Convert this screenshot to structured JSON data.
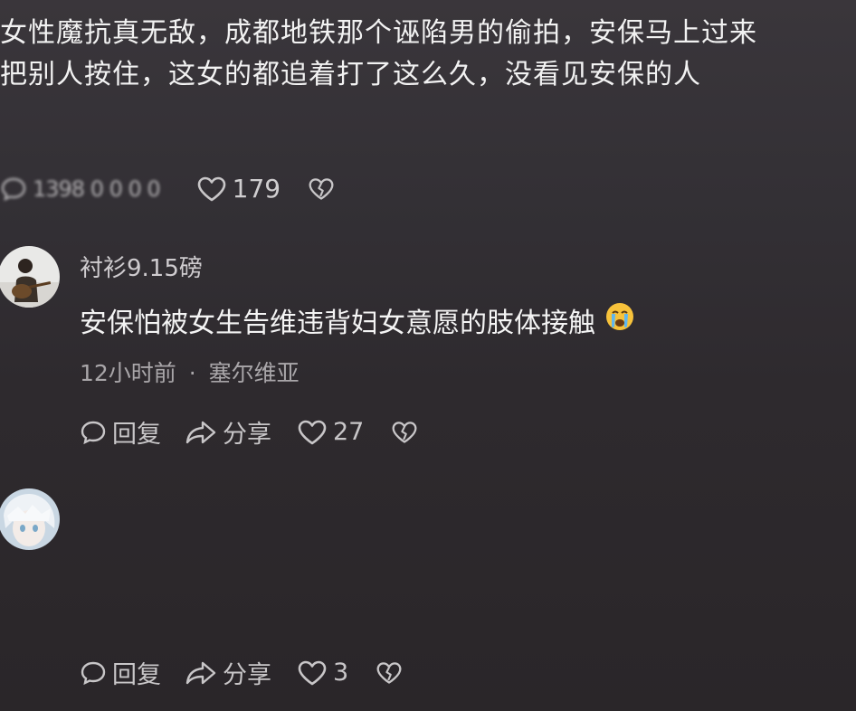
{
  "post": {
    "line1": "女性魔抗真无敌，成都地铁那个诬陷男的偷拍，安保马上过来",
    "line2": "把别人按住，这女的都追着打了这么久，没看见安保的人",
    "blurred_stats": "1398 0 0 0 0",
    "like_count": "179"
  },
  "comments": [
    {
      "username": "衬衫9.15磅",
      "text": "安保怕被女生告维违背妇女意愿的肢体接触",
      "emoji": "crying-face-emoji",
      "time": "12小时前",
      "separator": "·",
      "location": "塞尔维亚",
      "reply_label": "回复",
      "share_label": "分享",
      "like_count": "27"
    },
    {
      "reply_label": "回复",
      "share_label": "分享",
      "like_count": "3"
    }
  ],
  "colors": {
    "background_top": "#3a363b",
    "background_bottom": "#2a2629",
    "text_primary": "#f2f2f2",
    "text_secondary": "#a9a6a9",
    "icon": "#c8c6c8"
  }
}
